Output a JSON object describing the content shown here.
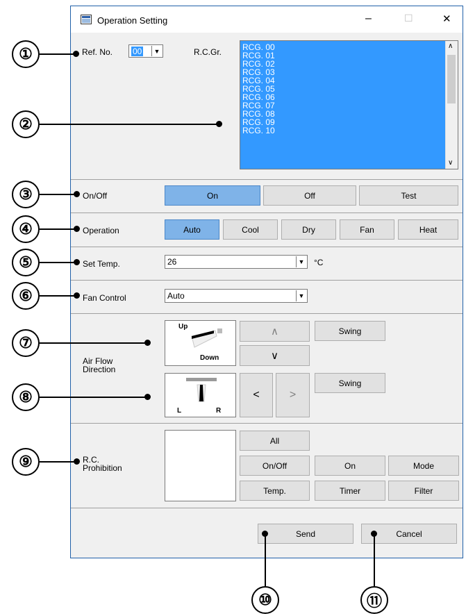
{
  "window": {
    "title": "Operation Setting",
    "controls": {
      "minimize": "–",
      "maximize": "☐",
      "close": "✕"
    }
  },
  "refno": {
    "label": "Ref. No.",
    "value": "00"
  },
  "rcgr": {
    "label": "R.C.Gr.",
    "items": [
      "RCG. 00",
      "RCG. 01",
      "RCG. 02",
      "RCG. 03",
      "RCG. 04",
      "RCG. 05",
      "RCG. 06",
      "RCG. 07",
      "RCG. 08",
      "RCG. 09",
      "RCG. 10"
    ]
  },
  "onoff": {
    "label": "On/Off",
    "on": "On",
    "off": "Off",
    "test": "Test",
    "selected": "On"
  },
  "operation": {
    "label": "Operation",
    "auto": "Auto",
    "cool": "Cool",
    "dry": "Dry",
    "fan": "Fan",
    "heat": "Heat",
    "selected": "Auto"
  },
  "settemp": {
    "label": "Set Temp.",
    "value": "26",
    "unit": "°C"
  },
  "fancontrol": {
    "label": "Fan Control",
    "value": "Auto"
  },
  "airflow": {
    "label": "Air Flow Direction",
    "vertical": {
      "up": "Up",
      "down": "Down",
      "swing": "Swing",
      "up_arrow": "∧",
      "down_arrow": "∨"
    },
    "horizontal": {
      "left": "L",
      "right": "R",
      "swing": "Swing",
      "left_arrow": "<",
      "right_arrow": ">"
    }
  },
  "prohibition": {
    "label": "R.C. Prohibition",
    "all": "All",
    "onoff": "On/Off",
    "on": "On",
    "mode": "Mode",
    "temp": "Temp.",
    "timer": "Timer",
    "filter": "Filter"
  },
  "footer": {
    "send": "Send",
    "cancel": "Cancel"
  },
  "callouts": [
    "①",
    "②",
    "③",
    "④",
    "⑤",
    "⑥",
    "⑦",
    "⑧",
    "⑨",
    "⑩",
    "⑪"
  ]
}
